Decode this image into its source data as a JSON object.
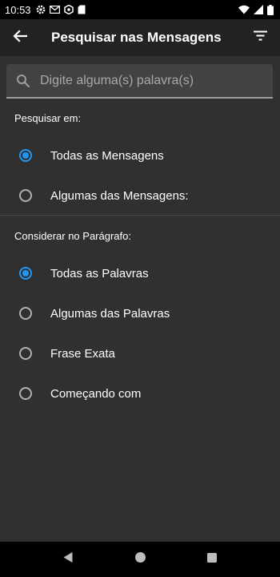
{
  "status_bar": {
    "time": "10:53",
    "left_icons": [
      "gear-icon",
      "gmail-icon",
      "settings-gear-icon",
      "sd-card-icon"
    ],
    "right_icons": [
      "wifi-icon",
      "signal-icon",
      "battery-icon"
    ]
  },
  "toolbar": {
    "title": "Pesquisar nas Mensagens",
    "back_icon": "arrow-back-icon",
    "filter_icon": "filter-icon"
  },
  "search": {
    "placeholder": "Digite alguma(s) palavra(s)",
    "value": ""
  },
  "search_in": {
    "label": "Pesquisar em:",
    "options": [
      {
        "label": "Todas as Mensagens",
        "selected": true
      },
      {
        "label": "Algumas das Mensagens:",
        "selected": false
      }
    ]
  },
  "paragraph": {
    "label": "Considerar no Parágrafo:",
    "options": [
      {
        "label": "Todas as Palavras",
        "selected": true
      },
      {
        "label": "Algumas das Palavras",
        "selected": false
      },
      {
        "label": "Frase Exata",
        "selected": false
      },
      {
        "label": "Começando com",
        "selected": false
      }
    ]
  },
  "nav_bar": {
    "icons": [
      "back-triangle-icon",
      "home-circle-icon",
      "recents-square-icon"
    ]
  },
  "colors": {
    "accent": "#2196f3",
    "background": "#303030",
    "toolbar": "#222222",
    "search_field": "#424242"
  }
}
